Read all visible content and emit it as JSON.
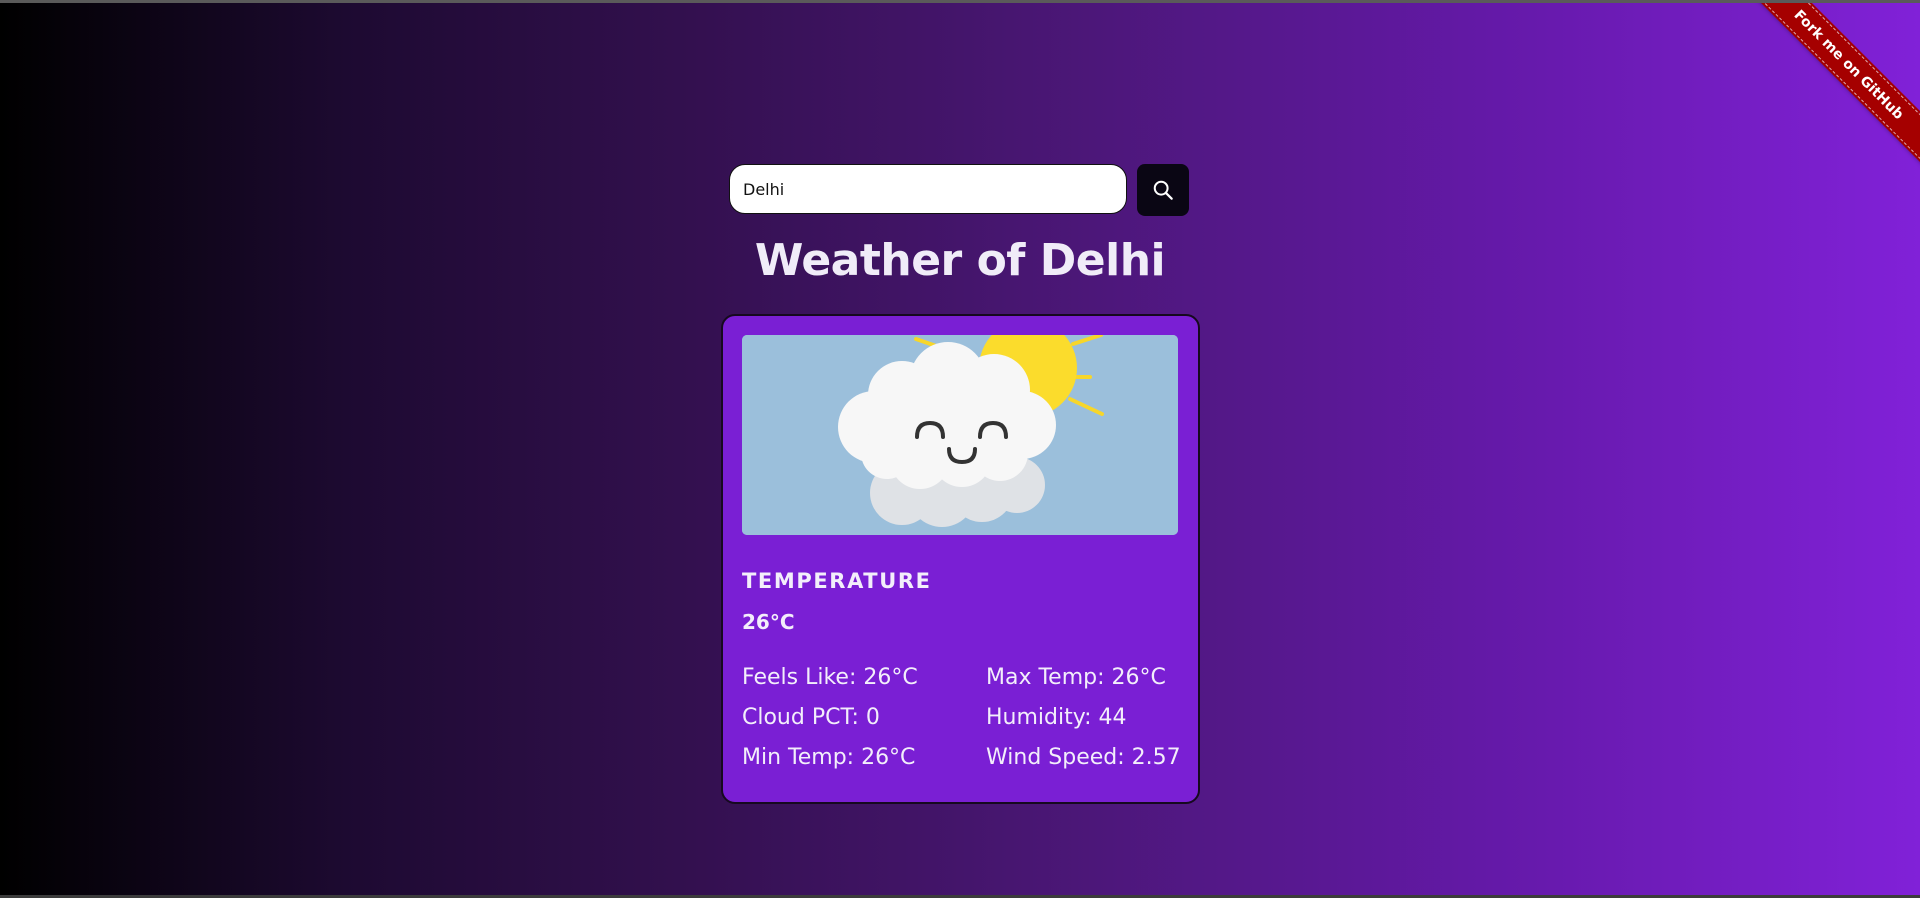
{
  "search": {
    "value": "Delhi",
    "placeholder": "",
    "button_icon": "search-icon"
  },
  "title": "Weather of Delhi",
  "card": {
    "image_icon": "smiling-cloud-with-sun",
    "temperature_heading": "Temperature",
    "temperature_value": "26°C",
    "stats": {
      "feels_like": "Feels Like: 26°C",
      "max_temp": "Max Temp: 26°C",
      "cloud_pct": "Cloud PCT: 0",
      "humidity": "Humidity: 44",
      "min_temp": "Min Temp: 26°C",
      "wind_speed": "Wind Speed: 2.57"
    }
  },
  "ribbon": {
    "label": "Fork me on GitHub"
  },
  "colors": {
    "gradient_start": "#000000",
    "gradient_end": "#8121d8",
    "card_bg": "#7a1fd4",
    "ribbon_bg": "#a50000",
    "button_bg": "#0a0614"
  }
}
